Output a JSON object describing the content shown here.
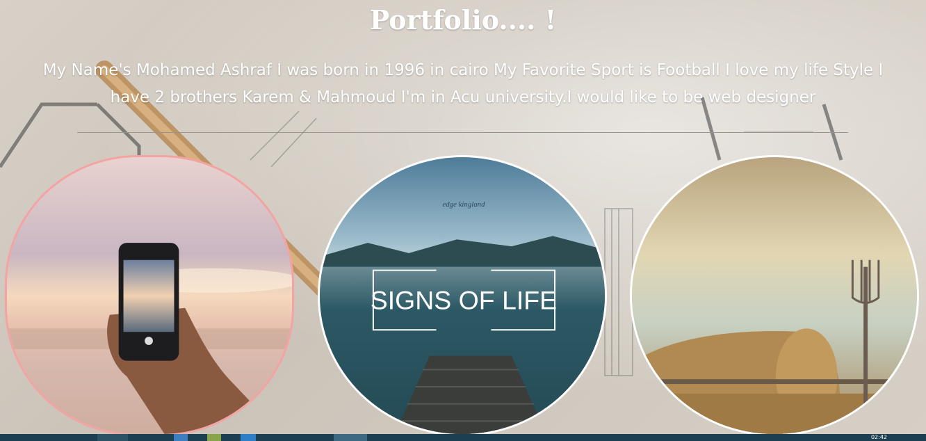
{
  "page": {
    "title": "Portfolio.... !",
    "bio": "My Name's Mohamed Ashraf I was born in 1996 in cairo My Favorite Sport is Football I love my life Style I have 2 brothers Karem & Mahmoud I'm in Acu university.I would like to be web designer"
  },
  "gallery": [
    {
      "name": "phone-sunset-photo",
      "caption": ""
    },
    {
      "name": "signs-of-life-photo",
      "caption": "SIGNS OF LIFE",
      "watermark": "edge kingland"
    },
    {
      "name": "haybale-pitchfork-photo",
      "caption": ""
    }
  ],
  "taskbar": {
    "clock": "02:42"
  },
  "colors": {
    "text": "#ffffff",
    "card_border_1": "#f4a3a3",
    "card_border": "#ffffff",
    "taskbar": "#1c3f52"
  }
}
